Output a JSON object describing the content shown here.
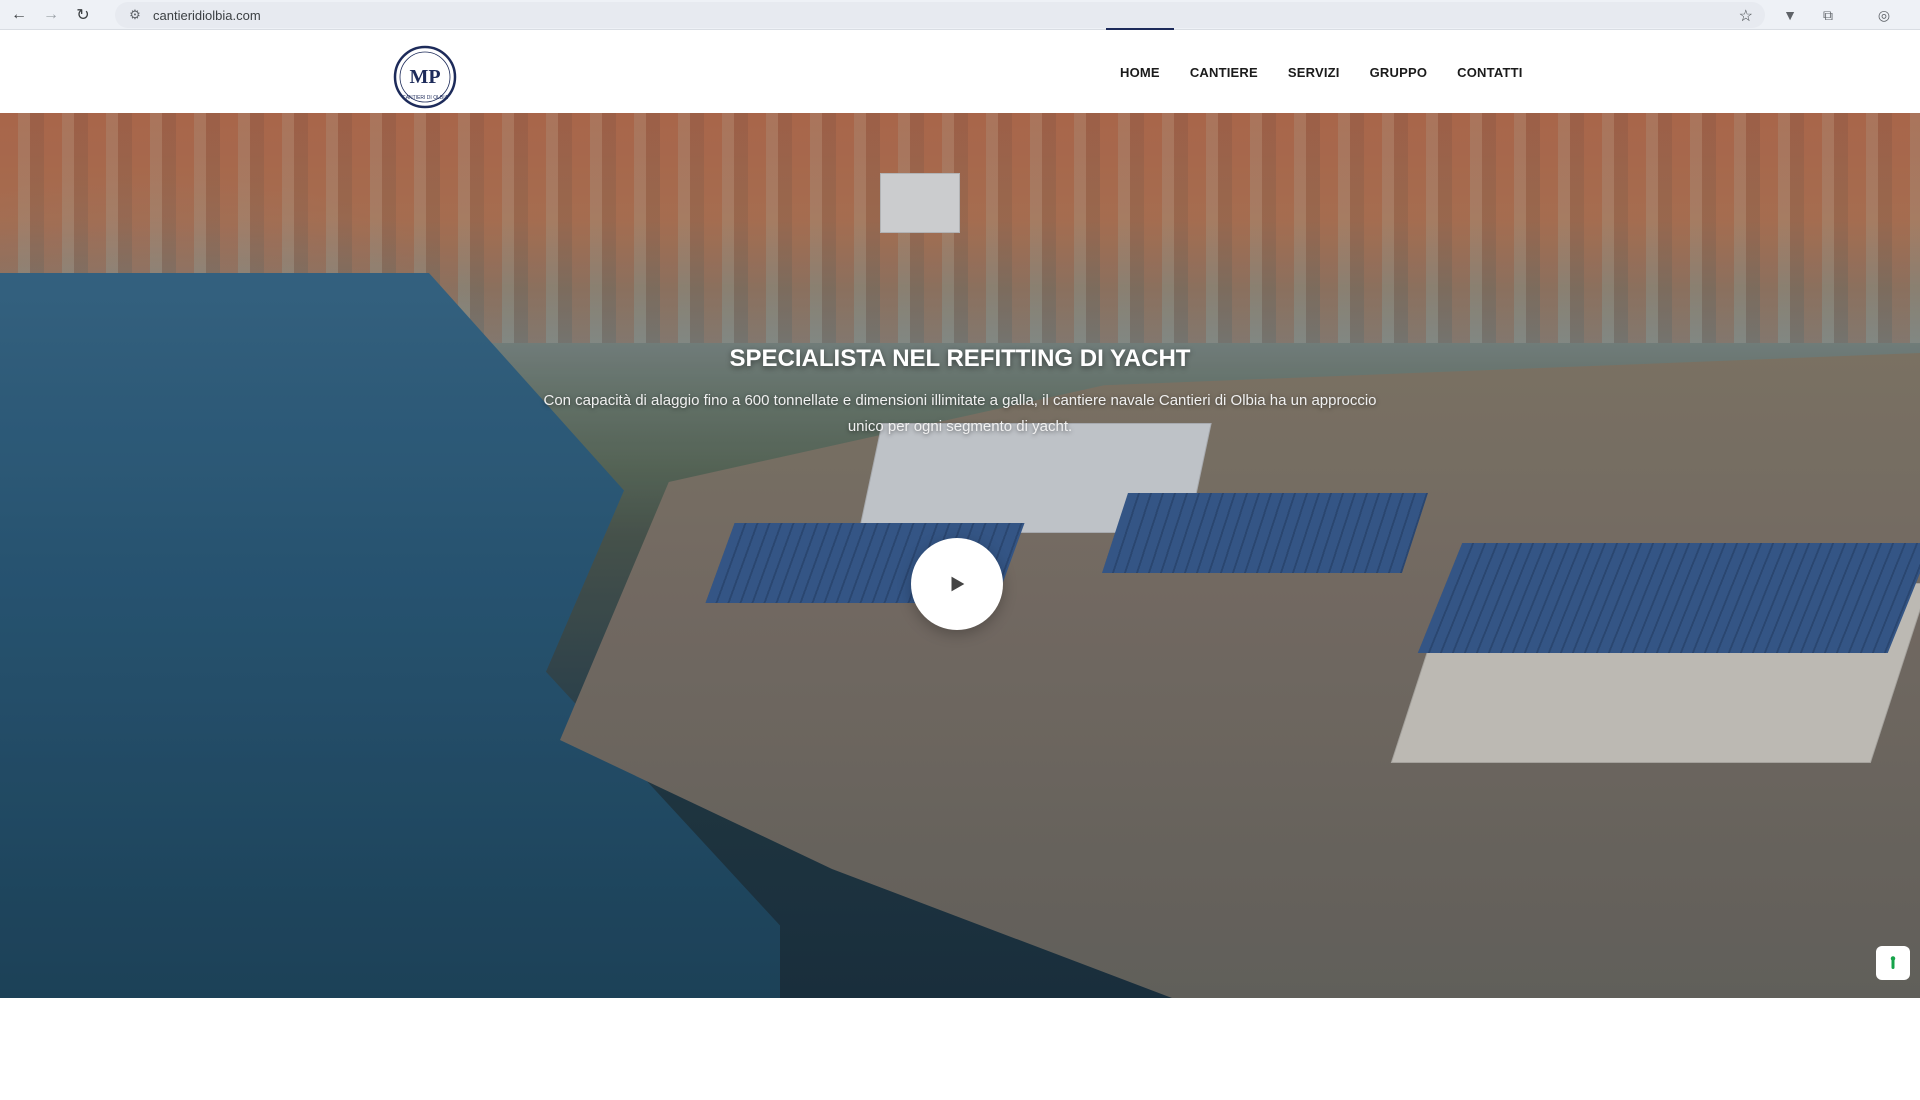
{
  "browser": {
    "url": "cantieridiolbia.com",
    "icons": {
      "back": "arrow-left-icon",
      "forward": "arrow-right-icon",
      "reload": "reload-icon",
      "site_info": "tune-icon",
      "bookmark": "star-icon",
      "extension1": "vpn-icon",
      "extension2": "puzzle-icon",
      "profile": "profile-icon"
    }
  },
  "header": {
    "logo_text": "CANTIERI DI OLBIA",
    "logo_monogram": "MP",
    "nav": [
      {
        "label": "HOME",
        "active": true
      },
      {
        "label": "CANTIERE",
        "active": false
      },
      {
        "label": "SERVIZI",
        "active": false
      },
      {
        "label": "GRUPPO",
        "active": false
      },
      {
        "label": "CONTATTI",
        "active": false
      }
    ]
  },
  "hero": {
    "title": "SPECIALISTA NEL REFITTING DI YACHT",
    "subtitle": "Con capacità di alaggio fino a 600 tonnellate e dimensioni illimitate a galla, il cantiere navale Cantieri di Olbia ha un approccio unico per ogni segmento di yacht.",
    "play_icon": "play-icon",
    "cookie_icon": "cookie-settings-icon"
  },
  "colors": {
    "accent": "#1d2b5a",
    "nav_text": "#1b1b1b",
    "cookie_green": "#16a34a"
  }
}
